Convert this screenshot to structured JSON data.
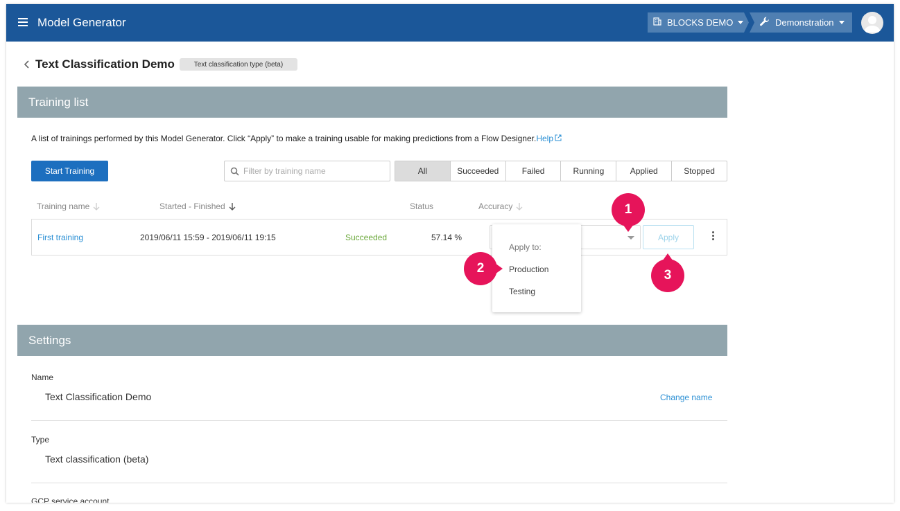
{
  "header": {
    "app_title": "Model Generator",
    "org": "BLOCKS DEMO",
    "project": "Demonstration",
    "colors": {
      "bar": "#1b5799",
      "crumb": "#4f7fb2"
    }
  },
  "page": {
    "title": "Text Classification Demo",
    "type_badge": "Text classification type (beta)"
  },
  "training": {
    "section_title": "Training list",
    "description": "A list of trainings performed by this Model Generator. Click “Apply” to make a training usable for making predictions from a Flow Designer.",
    "help_label": "Help",
    "start_button": "Start Training",
    "search_placeholder": "Filter by training name",
    "filters": [
      "All",
      "Succeeded",
      "Failed",
      "Running",
      "Applied",
      "Stopped"
    ],
    "columns": {
      "name": "Training name",
      "started": "Started - Finished",
      "status": "Status",
      "accuracy": "Accuracy"
    },
    "rows": [
      {
        "name": "First training",
        "period": "2019/06/11 15:59 - 2019/06/11 19:15",
        "status": "Succeeded",
        "accuracy": "57.14 %"
      }
    ],
    "apply_button": "Apply",
    "dropdown": {
      "header": "Apply to:",
      "options": [
        "Production",
        "Testing"
      ]
    }
  },
  "callouts": [
    "1",
    "2",
    "3"
  ],
  "settings": {
    "section_title": "Settings",
    "name_label": "Name",
    "name_value": "Text Classification Demo",
    "change_name": "Change name",
    "type_label": "Type",
    "type_value": "Text classification (beta)",
    "gcp_label": "GCP service account"
  },
  "colors": {
    "accent": "#1d6fbf",
    "link": "#2a8fd4",
    "success": "#6aa83a",
    "section_header": "#91a5ad",
    "callout": "#e6145a"
  }
}
